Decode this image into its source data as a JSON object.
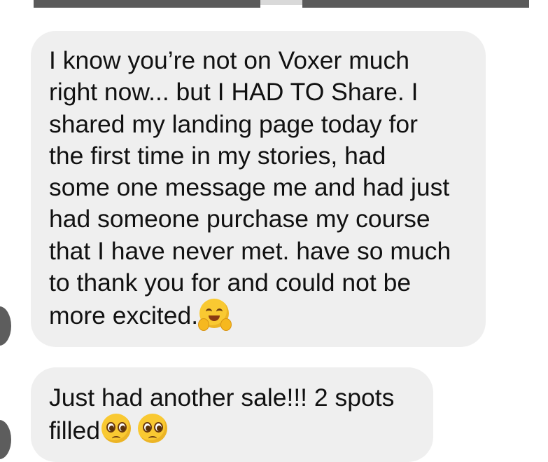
{
  "messages": [
    {
      "lines": [
        "I know you’re not on Voxer much",
        "right now... but I HAD TO Share. I",
        "shared my landing page today for",
        "the first time in my stories, had",
        "some one message me and had just",
        "had someone purchase my course",
        "that I have never met. have so much",
        "to thank you for and could not be",
        "more excited."
      ],
      "trailing_emoji": "hugging-face"
    },
    {
      "lines": [
        "Just had another sale!!! 2 spots",
        "filled"
      ],
      "trailing_emoji": [
        "pleading-face",
        "pleading-face"
      ]
    }
  ],
  "colors": {
    "bubble_background": "#efefef",
    "text": "#111111",
    "avatar": "#5d5d5d"
  }
}
